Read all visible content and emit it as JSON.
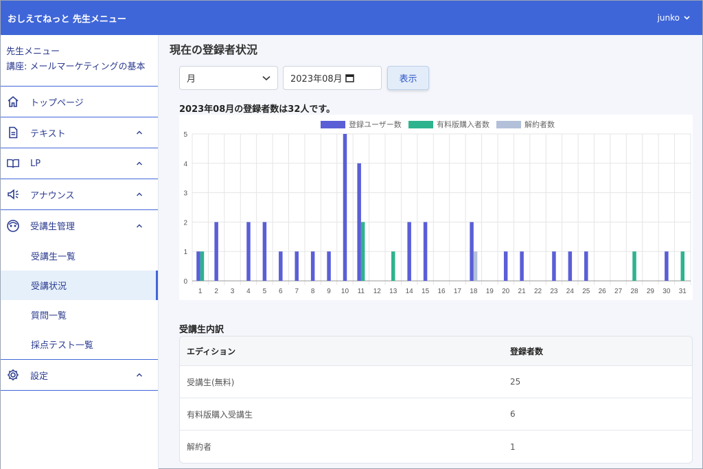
{
  "header": {
    "title": "おしえてねっと 先生メニュー",
    "user": "junko"
  },
  "sidebar": {
    "heading": "先生メニュー",
    "course": "講座: メールマーケティングの基本",
    "items": [
      {
        "label": "トップページ",
        "icon": "home-icon"
      },
      {
        "label": "テキスト",
        "icon": "document-icon"
      },
      {
        "label": "LP",
        "icon": "book-icon"
      },
      {
        "label": "アナウンス",
        "icon": "megaphone-icon"
      },
      {
        "label": "受講生管理",
        "icon": "users-icon"
      },
      {
        "label": "設定",
        "icon": "gear-icon"
      }
    ],
    "sub_items": [
      {
        "label": "受講生一覧",
        "active": false
      },
      {
        "label": "受講状況",
        "active": true
      },
      {
        "label": "質問一覧",
        "active": false
      },
      {
        "label": "採点テスト一覧",
        "active": false
      }
    ]
  },
  "main": {
    "title": "現在の登録者状況",
    "period_select": "月",
    "month_input": "2023年08月",
    "show_button": "表示",
    "summary": "2023年08月の登録者数は32人です。",
    "breakdown_title": "受講生内訳",
    "table": {
      "headers": [
        "エディション",
        "登録者数"
      ],
      "rows": [
        [
          "受講生(無料)",
          "25"
        ],
        [
          "有料版購入受講生",
          "6"
        ],
        [
          "解約者",
          "1"
        ]
      ]
    }
  },
  "chart_data": {
    "type": "bar",
    "categories": [
      "1",
      "2",
      "3",
      "4",
      "5",
      "6",
      "7",
      "8",
      "9",
      "10",
      "11",
      "12",
      "13",
      "14",
      "15",
      "16",
      "17",
      "18",
      "19",
      "20",
      "21",
      "22",
      "23",
      "24",
      "25",
      "26",
      "27",
      "28",
      "29",
      "30",
      "31"
    ],
    "series": [
      {
        "name": "登録ユーザー数",
        "color": "#5a5fd6",
        "values": [
          1,
          2,
          0,
          2,
          2,
          1,
          1,
          1,
          1,
          5,
          4,
          0,
          0,
          2,
          2,
          0,
          0,
          2,
          0,
          1,
          1,
          0,
          1,
          1,
          1,
          0,
          0,
          0,
          0,
          1,
          0
        ]
      },
      {
        "name": "有料版購入者数",
        "color": "#2eb38f",
        "values": [
          1,
          0,
          0,
          0,
          0,
          0,
          0,
          0,
          0,
          0,
          2,
          0,
          1,
          0,
          0,
          0,
          0,
          0,
          0,
          0,
          0,
          0,
          0,
          0,
          0,
          0,
          0,
          1,
          0,
          0,
          1
        ]
      },
      {
        "name": "解約者数",
        "color": "#b3c0d9",
        "values": [
          0,
          0,
          0,
          0,
          0,
          0,
          0,
          0,
          0,
          0,
          0,
          0,
          0,
          0,
          0,
          0,
          0,
          1,
          0,
          0,
          0,
          0,
          0,
          0,
          0,
          0,
          0,
          0,
          0,
          0,
          0
        ]
      }
    ],
    "ylim": [
      0,
      5
    ],
    "yticks": [
      "0",
      "1",
      "2",
      "3",
      "4",
      "5"
    ],
    "grid": true,
    "legend": "top-center"
  }
}
